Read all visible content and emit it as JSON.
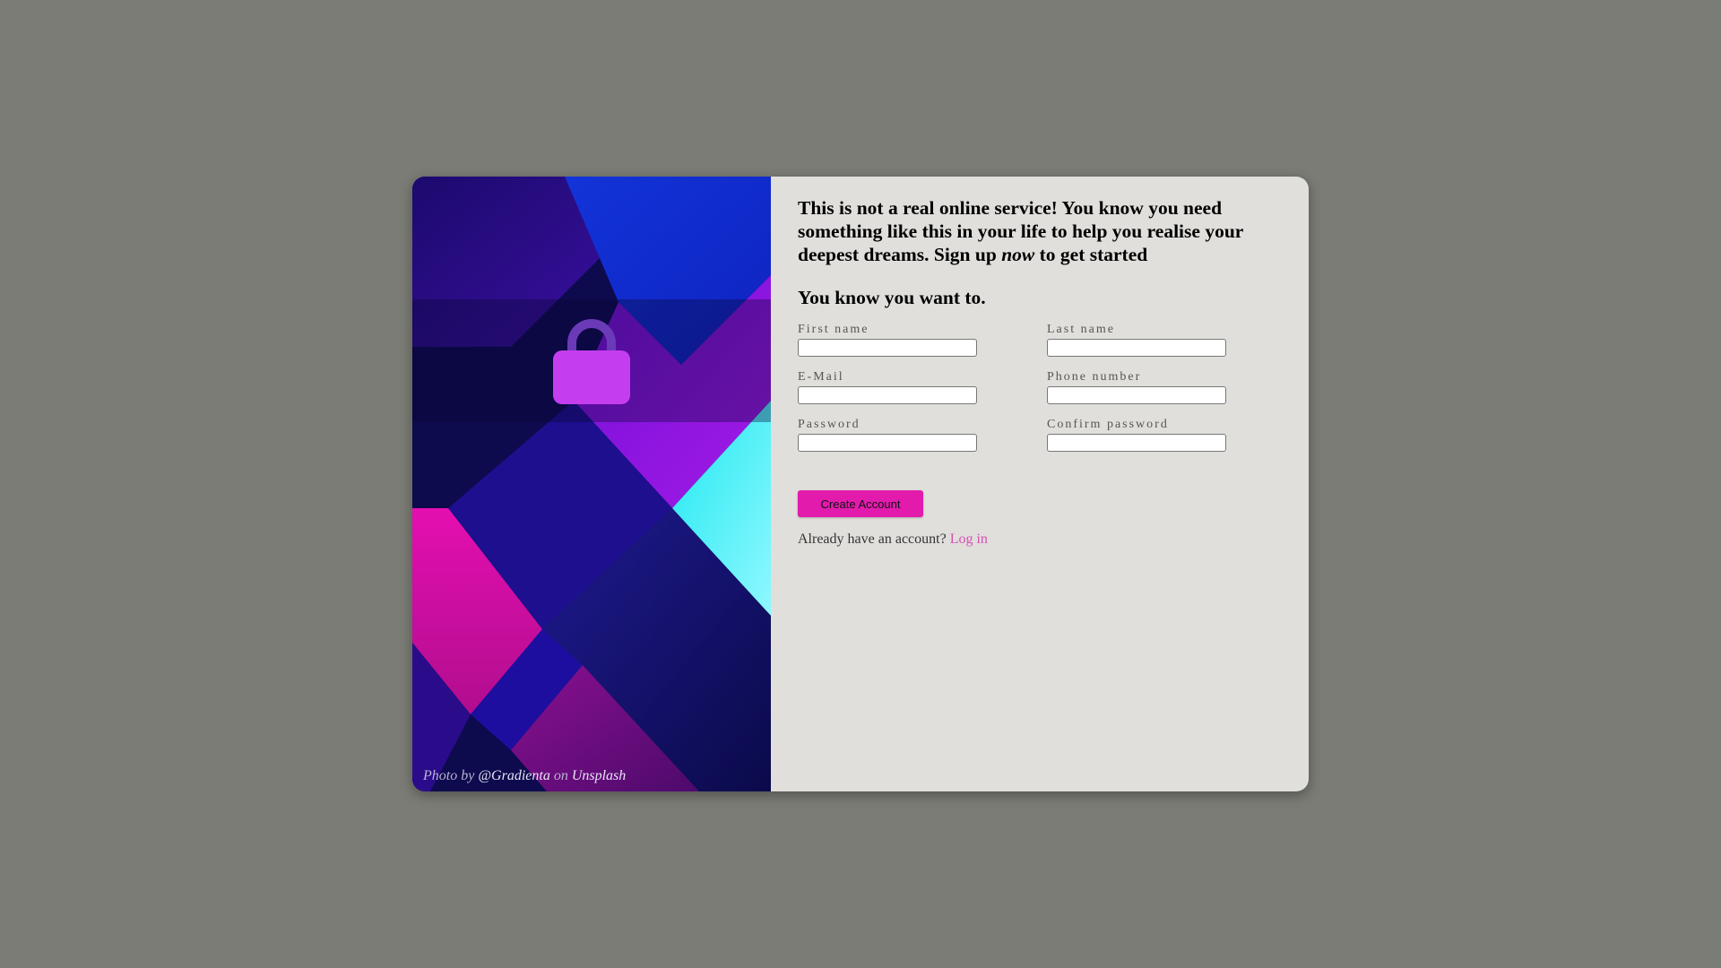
{
  "art": {
    "lock_icon": "lock-icon",
    "credit_prefix": "Photo by",
    "credit_author": "@Gradienta",
    "credit_on": "on",
    "credit_site": "Unsplash"
  },
  "form": {
    "heading_before": "This is not a real online service! You know you need something like this in your life to help you realise your deepest dreams. Sign up",
    "heading_emph": "now",
    "heading_after": "to get started",
    "subheading": "You know you want to.",
    "fields": {
      "first_name": {
        "label": "First name",
        "value": ""
      },
      "last_name": {
        "label": "Last name",
        "value": ""
      },
      "email": {
        "label": "E-Mail",
        "value": ""
      },
      "phone": {
        "label": "Phone number",
        "value": ""
      },
      "password": {
        "label": "Password",
        "value": ""
      },
      "confirm_password": {
        "label": "Confirm password",
        "value": ""
      }
    },
    "submit_label": "Create Account",
    "login_prompt": "Already have an account?",
    "login_link": "Log in"
  },
  "colors": {
    "page_bg": "#7c7c76",
    "panel_bg": "#e0dfdb",
    "accent": "#e21bad",
    "link": "#d84fb4"
  }
}
